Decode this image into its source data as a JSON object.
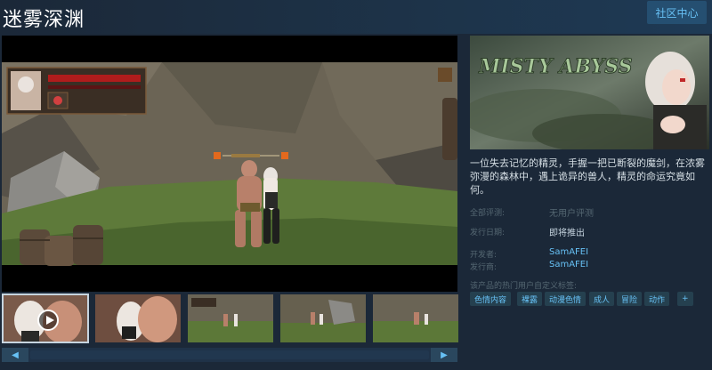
{
  "header": {
    "title": "迷雾深渊",
    "community_button": "社区中心"
  },
  "capsule": {
    "logo_text": "MISTY ABYSS"
  },
  "description": "一位失去记忆的精灵，手握一把已断裂的魔剑，在浓雾弥漫的森林中，遇上诡异的兽人，精灵的命运究竟如何。",
  "meta": {
    "review_label": "全部评测:",
    "review_value": "无用户评测",
    "release_label": "发行日期:",
    "release_value": "即将推出",
    "developer_label": "开发者:",
    "developer_value": "SamAFEI",
    "publisher_label": "发行商:",
    "publisher_value": "SamAFEI"
  },
  "tags_label": "该产品的热门用户自定义标签:",
  "tags": [
    "色情内容",
    "裸露",
    "动漫色情",
    "成人",
    "冒险",
    "动作",
    "+"
  ],
  "scroll": {
    "left": "◀",
    "right": "▶"
  },
  "thumbnails": [
    {
      "kind": "video",
      "active": true
    },
    {
      "kind": "image"
    },
    {
      "kind": "image"
    },
    {
      "kind": "image"
    },
    {
      "kind": "image"
    }
  ],
  "colors": {
    "background": "#1b2838",
    "link": "#67c1f5",
    "tag_bg": "#25404f",
    "health_bar": "#b01c1c"
  }
}
